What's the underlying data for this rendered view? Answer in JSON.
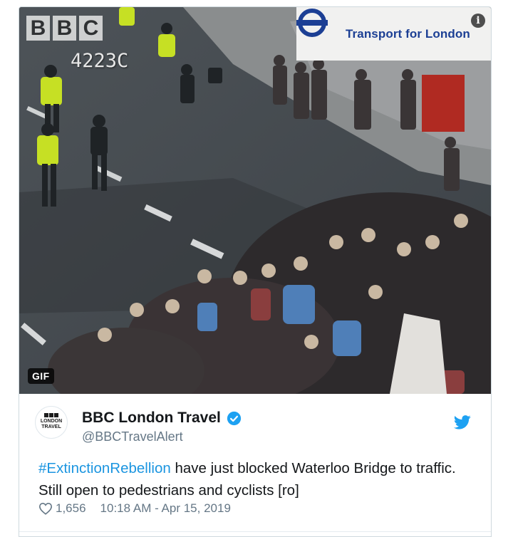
{
  "media": {
    "bbc_letters": [
      "B",
      "B",
      "C"
    ],
    "camera_id": "4223C",
    "tfl_label": "Transport for London",
    "info_glyph": "i",
    "badge": "GIF"
  },
  "author": {
    "avatar_line1": "LONDON",
    "avatar_line2": "TRAVEL",
    "display_name": "BBC London Travel",
    "handle": "@BBCTravelAlert",
    "verified_color": "#1da1f2"
  },
  "tweet": {
    "hashtag": "#ExtinctionRebellion",
    "text_line1_rest": " have just blocked Waterloo Bridge to traffic.",
    "text_line2": "Still open to pedestrians and cyclists [ro]",
    "likes": "1,656",
    "timestamp": "10:18 AM - Apr 15, 2019"
  },
  "colors": {
    "accent": "#1da1f2",
    "hashtag": "#1b95e0",
    "tfl_blue": "#1c3f94",
    "tfl_red": "#dc241f",
    "muted": "#657786"
  }
}
